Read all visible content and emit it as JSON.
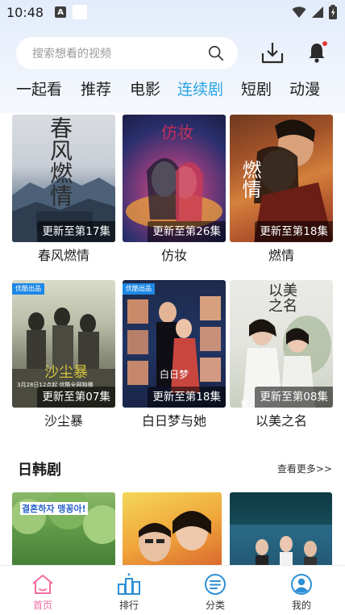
{
  "status_bar": {
    "time": "10:48",
    "a_badge": "A"
  },
  "search": {
    "placeholder": "搜索想看的视频"
  },
  "tabs": [
    {
      "label": "一起看",
      "active": false
    },
    {
      "label": "推荐",
      "active": false
    },
    {
      "label": "电影",
      "active": false
    },
    {
      "label": "连续剧",
      "active": true
    },
    {
      "label": "短剧",
      "active": false
    },
    {
      "label": "动漫",
      "active": false
    }
  ],
  "shows": [
    {
      "title": "春风燃情",
      "badge": "更新至第17集",
      "poster_text": "春风燃情"
    },
    {
      "title": "仿妆",
      "badge": "更新至第26集",
      "poster_text": "仿妆"
    },
    {
      "title": "燃情",
      "badge": "更新至第18集",
      "poster_text": "燃情"
    },
    {
      "title": "沙尘暴",
      "badge": "更新至第07集",
      "poster_text": "沙尘暴",
      "tag": "优酷出品",
      "date_text": "3月28日12点起 优酷全网独播"
    },
    {
      "title": "白日梦与她",
      "badge": "更新至第18集",
      "poster_text": "白日梦",
      "tag": "优酷出品"
    },
    {
      "title": "以美之名",
      "badge": "更新至第08集",
      "poster_text": "以美之名",
      "corner_text": "优"
    }
  ],
  "section": {
    "title": "日韩剧",
    "more": "查看更多>>"
  },
  "row2_posters": [
    {
      "text": "결혼하자 맹꽁아!"
    },
    {
      "text": ""
    },
    {
      "text": ""
    }
  ],
  "bottom_nav": [
    {
      "label": "首页",
      "icon": "home-icon",
      "active": true
    },
    {
      "label": "排行",
      "icon": "ranking-icon",
      "active": false
    },
    {
      "label": "分类",
      "icon": "category-icon",
      "active": false
    },
    {
      "label": "我的",
      "icon": "profile-icon",
      "active": false
    }
  ],
  "colors": {
    "accent": "#2ba4e6",
    "nav_active": "#f06ea2",
    "badge_dot": "#e53935"
  }
}
